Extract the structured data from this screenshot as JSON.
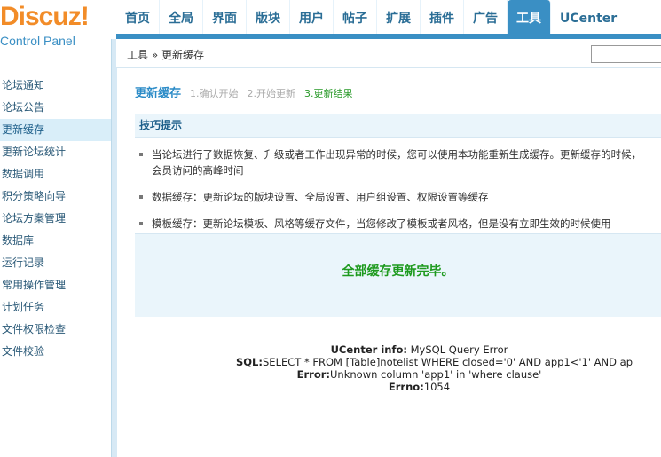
{
  "logo": {
    "brand": "Discuz",
    "bang": "!",
    "subtitle": "Control Panel"
  },
  "nav": [
    "首页",
    "全局",
    "界面",
    "版块",
    "用户",
    "帖子",
    "扩展",
    "插件",
    "广告",
    "工具",
    "UCenter"
  ],
  "nav_active": "工具",
  "breadcrumb": "工具 » 更新缓存",
  "sidebar": [
    "论坛通知",
    "论坛公告",
    "更新缓存",
    "更新论坛统计",
    "数据调用",
    "积分策略向导",
    "论坛方案管理",
    "数据库",
    "运行记录",
    "常用操作管理",
    "计划任务",
    "文件权限检查",
    "文件校验"
  ],
  "sidebar_active": "更新缓存",
  "steps": {
    "title": "更新缓存",
    "step1": "1.确认开始",
    "step2": "2.开始更新",
    "step3": "3.更新结果"
  },
  "tips": {
    "heading": "技巧提示",
    "items": [
      "当论坛进行了数据恢复、升级或者工作出现异常的时候，您可以使用本功能重新生成缓存。更新缓存的时候，",
      "会员访问的高峰时间",
      "数据缓存：更新论坛的版块设置、全局设置、用户组设置、权限设置等缓存",
      "模板缓存：更新论坛模板、风格等缓存文件，当您修改了模板或者风格，但是没有立即生效的时候使用"
    ]
  },
  "result_message": "全部缓存更新完毕。",
  "error": {
    "info_label": "UCenter info:",
    "info_value": " MySQL Query Error",
    "sql_label": "SQL:",
    "sql_value": "SELECT * FROM [Table]notelist WHERE closed='0' AND app1<'1' AND ap",
    "error_label": "Error:",
    "error_value": "Unknown column 'app1' in 'where clause'",
    "errno_label": "Errno:",
    "errno_value": "1054"
  },
  "colors": {
    "accent": "#3a8fc4",
    "logo": "#f28c28",
    "success": "#1e9a1e"
  }
}
